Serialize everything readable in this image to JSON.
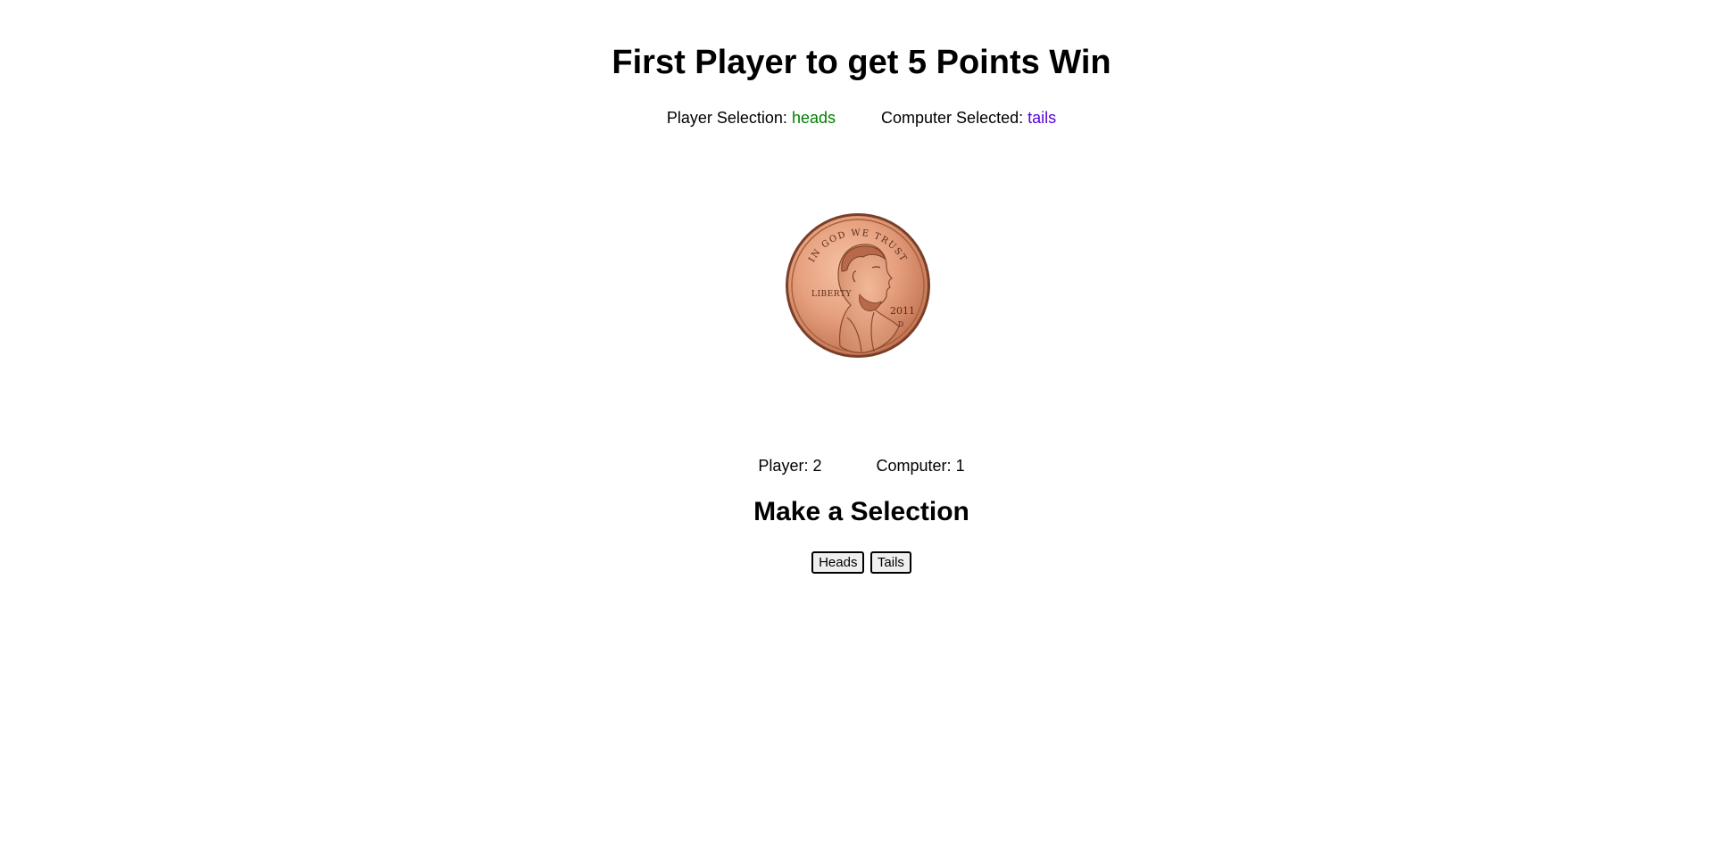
{
  "header": {
    "title": "First Player to get 5 Points Win"
  },
  "selections": {
    "player_label": "Player Selection:",
    "player_value": "heads",
    "player_color": "#008000",
    "computer_label": "Computer Selected:",
    "computer_value": "tails",
    "computer_color": "#5500dd"
  },
  "coin": {
    "icon": "penny-coin-icon",
    "motto": "IN GOD WE TRUST",
    "liberty": "LIBERTY",
    "year": "2011",
    "mint": "D"
  },
  "scores": {
    "player_label": "Player:",
    "player_score": "2",
    "computer_label": "Computer:",
    "computer_score": "1"
  },
  "prompt": {
    "text": "Make a Selection"
  },
  "buttons": {
    "heads_label": "Heads",
    "tails_label": "Tails"
  }
}
